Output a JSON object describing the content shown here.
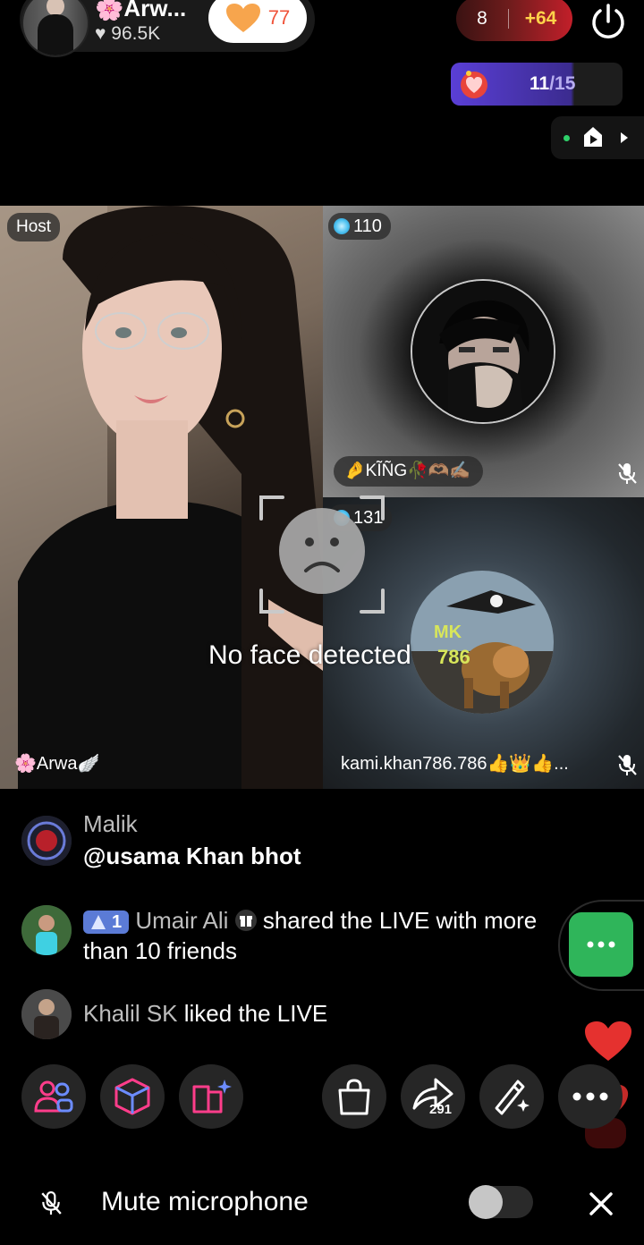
{
  "header": {
    "host_name": "🌸Arw...",
    "host_likes": "♥ 96.5K",
    "likes_button_count": "77",
    "score_left": "8",
    "score_right": "+64",
    "mission_done": "11",
    "mission_total": "/15"
  },
  "stage": {
    "host_chip": "Host",
    "host_name": "🌸Arwa🪽",
    "guest1_coins": "110",
    "guest1_name": "🤌KĨÑG🥀🫶🏽✍🏽",
    "guest2_coins": "131",
    "guest2_name": "kami.khan786.786👍👑👍...",
    "guest2_avatar_text_a": "MK",
    "guest2_avatar_text_b": "786",
    "face_warning": "No face detected"
  },
  "chat": [
    {
      "user": "Malik",
      "message": "@usama Khan bhot"
    },
    {
      "level": "1",
      "user": "Umair Ali",
      "message_line1": " shared the LIVE with more",
      "message_line2": "than 10 friends"
    },
    {
      "user": "Khalil SK",
      "message": " liked the LIVE"
    }
  ],
  "toolbar": {
    "share_count": "291"
  },
  "mute_bar": {
    "label": "Mute microphone",
    "toggle_on": false
  },
  "colors": {
    "green_accent": "#2fb55a",
    "pink_icon": "#ff3d8b",
    "score_gold": "#ffd24a",
    "heart_red": "#e5312f"
  }
}
